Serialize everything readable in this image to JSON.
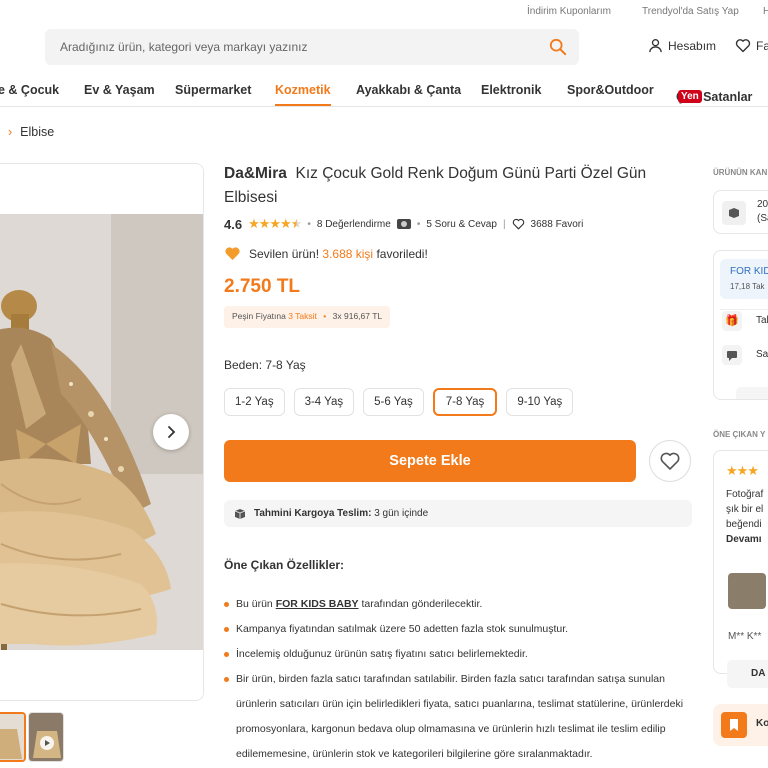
{
  "topbar": {
    "links": [
      "İndirim Kuponlarım",
      "Trendyol'da Satış Yap",
      "H"
    ]
  },
  "search": {
    "placeholder": "Aradığınız ürün, kategori veya markayı yazınız"
  },
  "header": {
    "account_label": "Hesabım",
    "favorites_label": "Fa"
  },
  "nav": {
    "items": [
      "e & Çocuk",
      "Ev & Yaşam",
      "Süpermarket",
      "Kozmetik",
      "Ayakkabı & Çanta",
      "Elektronik",
      "Spor&Outdoor",
      "Çok Satanlar"
    ],
    "active_index": 3,
    "badge": "Yen"
  },
  "breadcrumb": {
    "last": "Elbise"
  },
  "product": {
    "brand": "Da&Mira",
    "name": "Kız Çocuk Gold Renk Doğum Günü Parti Özel Gün Elbisesi",
    "rating": "4.6",
    "stars": 4.5,
    "reviews": "8 Değerlendirme",
    "questions": "5 Soru & Cevap",
    "favorites": "3688 Favori",
    "loved_prefix": "Sevilen ürün!",
    "loved_count": "3.688 kişi",
    "loved_suffix": "favoriledi!",
    "price": "2.750 TL",
    "taksit_prefix": "Peşin Fiyatına",
    "taksit_highlight": "3 Taksit",
    "taksit_amount": "3x 916,67 TL",
    "size_label": "Beden:",
    "size_selected": "7-8 Yaş",
    "sizes": [
      "1-2 Yaş",
      "3-4 Yaş",
      "5-6 Yaş",
      "7-8 Yaş",
      "9-10 Yaş"
    ],
    "selected_size_index": 3,
    "add_to_cart": "Sepete Ekle",
    "cargo_label": "Tahmini Kargoya Teslim:",
    "cargo_value": "3 gün içinde"
  },
  "features": {
    "title": "Öne Çıkan Özellikler:",
    "item1_pre": "Bu ürün",
    "item1_link": "FOR KIDS BABY",
    "item1_post": "tarafından gönderilecektir.",
    "items": [
      "Kampanya fiyatından satılmak üzere 50 adetten fazla stok sunulmuştur.",
      "İncelemiş olduğunuz ürünün satış fiyatını satıcı belirlemektedir.",
      "Bir ürün, birden fazla satıcı tarafından satılabilir. Birden fazla satıcı tarafından satışa sunulan ürünlerin satıcıları ürün için belirledikleri fiyata, satıcı puanlarına, teslimat statülerine, ürünlerdeki promosyonlara, kargonun bedava olup olmamasına ve ürünlerin hızlı teslimat ile teslim edilip edilememesine, ürünlerin stok ve kategorileri bilgilerine göre sıralanmaktadır."
    ]
  },
  "sidebar": {
    "campaigns_label": "ÜRÜNÜN KAN",
    "campaign_line1": "20",
    "campaign_line2": "(Sa",
    "seller_name": "FOR KID",
    "seller_sub": "17,18 Tak",
    "row1": "Tal",
    "row2": "Sa",
    "reviews_label": "ÖNE ÇIKAN Y",
    "review_text": [
      "Fotoğraf",
      "şık bir el",
      "beğendi",
      "Devamı"
    ],
    "reviewer": "M** K**",
    "review_btn": "DA",
    "bottom_btn": "Ko"
  },
  "colors": {
    "accent": "#f27a1a",
    "star": "#f5a623",
    "badge": "#d0021b"
  }
}
